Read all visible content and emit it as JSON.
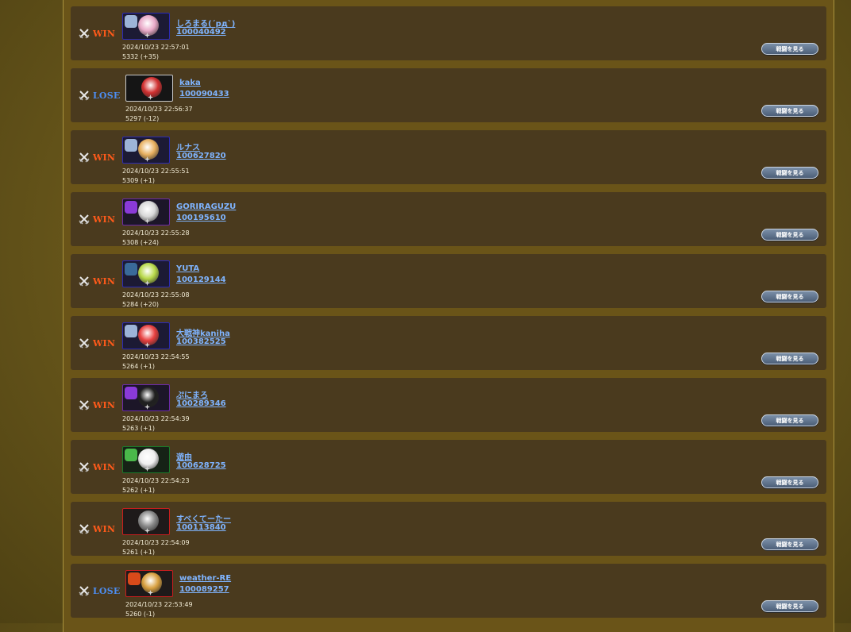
{
  "battles": [
    {
      "result": "WIN",
      "name": "しろまる(´pд`)",
      "player_id": "100040492",
      "time": "2024/10/23 22:57:01",
      "rating": "5332 (+35)",
      "frame": "blue",
      "face_color": "#e9a9c8",
      "badge_color": "#9db4d8",
      "button": "戦闘を見る"
    },
    {
      "result": "LOSE",
      "name": "kaka",
      "player_id": "100090433",
      "time": "2024/10/23 22:56:37",
      "rating": "5297 (-12)",
      "frame": "white",
      "face_color": "#d03030",
      "badge_color": "",
      "button": "戦闘を見る"
    },
    {
      "result": "WIN",
      "name": "ルナス",
      "player_id": "100627820",
      "time": "2024/10/23 22:55:51",
      "rating": "5309 (+1)",
      "frame": "blue",
      "face_color": "#e8b060",
      "badge_color": "#9db4d8",
      "button": "戦闘を見る"
    },
    {
      "result": "WIN",
      "name": "GORIRAGUZU",
      "player_id": "100195610",
      "time": "2024/10/23 22:55:28",
      "rating": "5308 (+24)",
      "frame": "purple",
      "face_color": "#d8d8d8",
      "badge_color": "#8a3ad8",
      "button": "戦闘を見る"
    },
    {
      "result": "WIN",
      "name": "YUTA",
      "player_id": "100129144",
      "time": "2024/10/23 22:55:08",
      "rating": "5284 (+20)",
      "frame": "blue",
      "face_color": "#b8d84a",
      "badge_color": "#3a6a9a",
      "button": "戦闘を見る"
    },
    {
      "result": "WIN",
      "name": "大戦神kaniha",
      "player_id": "100382525",
      "time": "2024/10/23 22:54:55",
      "rating": "5264 (+1)",
      "frame": "blue",
      "face_color": "#e84040",
      "badge_color": "#9db4d8",
      "button": "戦闘を見る"
    },
    {
      "result": "WIN",
      "name": "ぷにまろ",
      "player_id": "100289346",
      "time": "2024/10/23 22:54:39",
      "rating": "5263 (+1)",
      "frame": "purple",
      "face_color": "#202020",
      "badge_color": "#8a3ad8",
      "button": "戦闘を見る"
    },
    {
      "result": "WIN",
      "name": "遊由",
      "player_id": "100628725",
      "time": "2024/10/23 22:54:23",
      "rating": "5262 (+1)",
      "frame": "green",
      "face_color": "#f0f0f0",
      "badge_color": "#4ab84a",
      "button": "戦闘を見る"
    },
    {
      "result": "WIN",
      "name": "すべくてーたー",
      "player_id": "100113840",
      "time": "2024/10/23 22:54:09",
      "rating": "5261 (+1)",
      "frame": "red",
      "face_color": "#8a8a8a",
      "badge_color": "",
      "button": "戦闘を見る"
    },
    {
      "result": "LOSE",
      "name": "weather-RE",
      "player_id": "100089257",
      "time": "2024/10/23 22:53:49",
      "rating": "5260 (-1)",
      "frame": "red",
      "face_color": "#d8a040",
      "badge_color": "#d84a1a",
      "button": "戦闘を見る"
    }
  ]
}
